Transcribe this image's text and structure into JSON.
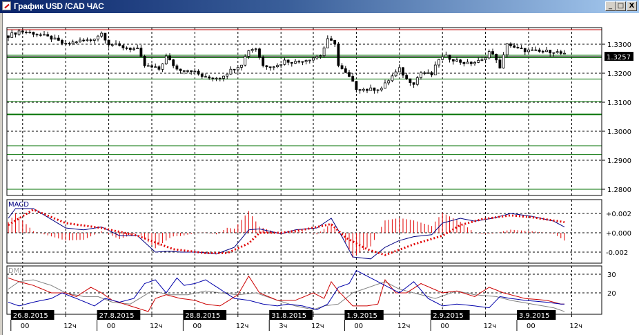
{
  "window": {
    "title": "График USD /CAD  ЧАС",
    "minimize": "_",
    "maximize": "□",
    "close": "X"
  },
  "colors": {
    "candle": "#000000",
    "resistance": "#c00000",
    "support": "#007000",
    "macd": "#000080",
    "signal": "#e00000",
    "plus_di": "#cc0000",
    "minus_di": "#0000aa",
    "adx": "#808080"
  },
  "price_axis": {
    "ticks": [
      "1.3300",
      "1.3200",
      "1.3100",
      "1.3000",
      "1.2900",
      "1.2800"
    ],
    "tick_values": [
      1.33,
      1.32,
      1.31,
      1.3,
      1.29,
      1.28
    ],
    "current_price": "1.3257",
    "current_value": 1.3257
  },
  "levels": {
    "red": [
      1.335
    ],
    "green": [
      1.3262,
      1.3254,
      1.318,
      1.3102,
      1.3058,
      1.295,
      1.292,
      1.28
    ]
  },
  "macd_panel": {
    "label": "MACD",
    "ticks": [
      "+0.002",
      "+0.000",
      "-0.002"
    ],
    "tick_values": [
      0.002,
      0,
      -0.002
    ]
  },
  "dmi_panel": {
    "label": "DMI",
    "ticks": [
      "30",
      "20"
    ],
    "tick_values": [
      30,
      20
    ]
  },
  "time_axis": {
    "labels": [
      "00",
      "12ч",
      "00",
      "12ч",
      "00",
      "12ч",
      "3ч",
      "12ч",
      "00",
      "12ч",
      "00",
      "12ч",
      "00",
      "12ч"
    ],
    "label_bars": [
      4,
      16,
      28,
      40,
      52,
      64,
      76,
      85,
      97,
      109,
      121,
      133,
      145,
      157
    ],
    "dates": [
      "26.8.2015",
      "27.8.2015",
      "28.8.2015",
      "31.8.2015",
      "1.9.2015",
      "2.9.2015",
      "3.9.2015"
    ],
    "date_bars": [
      4,
      28,
      52,
      76,
      97,
      121,
      145
    ]
  },
  "chart_data": {
    "type": "candlestick",
    "symbol": "USD/CAD",
    "timeframe": "H1",
    "bars": 156,
    "close_anchors": [
      [
        0,
        1.3329
      ],
      [
        3,
        1.3345
      ],
      [
        7,
        1.3338
      ],
      [
        12,
        1.3321
      ],
      [
        16,
        1.3298
      ],
      [
        19,
        1.331
      ],
      [
        23,
        1.3314
      ],
      [
        26,
        1.3338
      ],
      [
        28,
        1.3302
      ],
      [
        32,
        1.329
      ],
      [
        36,
        1.3281
      ],
      [
        38,
        1.3226
      ],
      [
        42,
        1.3214
      ],
      [
        44,
        1.3257
      ],
      [
        47,
        1.3214
      ],
      [
        51,
        1.321
      ],
      [
        55,
        1.3183
      ],
      [
        59,
        1.3186
      ],
      [
        62,
        1.321
      ],
      [
        65,
        1.3233
      ],
      [
        67,
        1.3281
      ],
      [
        69,
        1.3286
      ],
      [
        71,
        1.3226
      ],
      [
        75,
        1.3226
      ],
      [
        77,
        1.3243
      ],
      [
        80,
        1.3238
      ],
      [
        84,
        1.325
      ],
      [
        87,
        1.3262
      ],
      [
        89,
        1.3314
      ],
      [
        91,
        1.3305
      ],
      [
        92,
        1.3226
      ],
      [
        95,
        1.3186
      ],
      [
        97,
        1.3148
      ],
      [
        100,
        1.3143
      ],
      [
        104,
        1.3148
      ],
      [
        107,
        1.319
      ],
      [
        109,
        1.3214
      ],
      [
        111,
        1.3179
      ],
      [
        113,
        1.3167
      ],
      [
        115,
        1.3202
      ],
      [
        118,
        1.3195
      ],
      [
        120,
        1.325
      ],
      [
        122,
        1.3257
      ],
      [
        125,
        1.3243
      ],
      [
        128,
        1.3233
      ],
      [
        132,
        1.3243
      ],
      [
        134,
        1.3274
      ],
      [
        136,
        1.325
      ],
      [
        137,
        1.3214
      ],
      [
        139,
        1.3305
      ],
      [
        141,
        1.3286
      ],
      [
        144,
        1.3279
      ],
      [
        148,
        1.3274
      ],
      [
        152,
        1.3276
      ],
      [
        155,
        1.3264
      ]
    ],
    "macd_anchors": [
      [
        0,
        0.0015
      ],
      [
        2,
        0.0025
      ],
      [
        7,
        0.0025
      ],
      [
        16,
        0.0005
      ],
      [
        21,
        0.0003
      ],
      [
        26,
        0.0006
      ],
      [
        31,
        -0.0003
      ],
      [
        36,
        -0.0003
      ],
      [
        41,
        -0.002
      ],
      [
        45,
        -0.0019
      ],
      [
        48,
        -0.002
      ],
      [
        53,
        -0.002
      ],
      [
        58,
        -0.0022
      ],
      [
        63,
        -0.0015
      ],
      [
        67,
        0.0003
      ],
      [
        70,
        0.0004
      ],
      [
        76,
        -0.0001
      ],
      [
        80,
        0.0003
      ],
      [
        86,
        0.0005
      ],
      [
        90,
        0.0015
      ],
      [
        93,
        -0.0004
      ],
      [
        96,
        -0.0025
      ],
      [
        101,
        -0.0027
      ],
      [
        105,
        -0.0015
      ],
      [
        109,
        -0.0008
      ],
      [
        113,
        -0.0004
      ],
      [
        118,
        -0.0002
      ],
      [
        121,
        0.001
      ],
      [
        126,
        0.0015
      ],
      [
        130,
        0.0012
      ],
      [
        135,
        0.0015
      ],
      [
        140,
        0.002
      ],
      [
        146,
        0.0017
      ],
      [
        152,
        0.0012
      ],
      [
        155,
        0.0006
      ]
    ],
    "signal_anchors": [
      [
        0,
        0.0008
      ],
      [
        7,
        0.0024
      ],
      [
        16,
        0.001
      ],
      [
        26,
        0.0005
      ],
      [
        36,
        -0.0003
      ],
      [
        46,
        -0.0017
      ],
      [
        55,
        -0.0021
      ],
      [
        61,
        -0.0021
      ],
      [
        67,
        -0.0011
      ],
      [
        70,
        0
      ],
      [
        76,
        0
      ],
      [
        82,
        0.0003
      ],
      [
        90,
        0.0009
      ],
      [
        94,
        -0.0005
      ],
      [
        100,
        -0.0017
      ],
      [
        105,
        -0.0023
      ],
      [
        113,
        -0.0012
      ],
      [
        121,
        -0.0003
      ],
      [
        126,
        0.0008
      ],
      [
        132,
        0.0014
      ],
      [
        140,
        0.0018
      ],
      [
        146,
        0.0016
      ],
      [
        155,
        0.0011
      ]
    ],
    "minus_di_anchors": [
      [
        0,
        15
      ],
      [
        3,
        13
      ],
      [
        7,
        15
      ],
      [
        12,
        17
      ],
      [
        15,
        20
      ],
      [
        19,
        17
      ],
      [
        24,
        13
      ],
      [
        27,
        17
      ],
      [
        31,
        15
      ],
      [
        35,
        17
      ],
      [
        38,
        25
      ],
      [
        41,
        27
      ],
      [
        44,
        20
      ],
      [
        47,
        28
      ],
      [
        49,
        24
      ],
      [
        52,
        25
      ],
      [
        55,
        27
      ],
      [
        59,
        22
      ],
      [
        63,
        17
      ],
      [
        67,
        16
      ],
      [
        71,
        14
      ],
      [
        75,
        13
      ],
      [
        78,
        14
      ],
      [
        82,
        13
      ],
      [
        86,
        11
      ],
      [
        89,
        14
      ],
      [
        92,
        23
      ],
      [
        95,
        25
      ],
      [
        97,
        32
      ],
      [
        100,
        29
      ],
      [
        105,
        24
      ],
      [
        109,
        20
      ],
      [
        113,
        26
      ],
      [
        117,
        17
      ],
      [
        121,
        13
      ],
      [
        125,
        14
      ],
      [
        130,
        13
      ],
      [
        134,
        12
      ],
      [
        137,
        18
      ],
      [
        140,
        17
      ],
      [
        144,
        16
      ],
      [
        150,
        15
      ],
      [
        154,
        14
      ]
    ],
    "plus_di_anchors": [
      [
        0,
        28
      ],
      [
        3,
        26
      ],
      [
        7,
        24
      ],
      [
        12,
        20
      ],
      [
        16,
        20
      ],
      [
        19,
        18
      ],
      [
        23,
        23
      ],
      [
        26,
        20
      ],
      [
        29,
        16
      ],
      [
        34,
        13
      ],
      [
        39,
        10
      ],
      [
        41,
        17
      ],
      [
        44,
        19
      ],
      [
        48,
        17
      ],
      [
        52,
        16
      ],
      [
        55,
        14
      ],
      [
        59,
        13
      ],
      [
        64,
        19
      ],
      [
        67,
        29
      ],
      [
        70,
        20
      ],
      [
        75,
        16
      ],
      [
        80,
        16
      ],
      [
        85,
        20
      ],
      [
        88,
        17
      ],
      [
        90,
        26
      ],
      [
        92,
        21
      ],
      [
        96,
        13
      ],
      [
        100,
        13
      ],
      [
        103,
        14
      ],
      [
        105,
        27
      ],
      [
        108,
        20
      ],
      [
        111,
        20
      ],
      [
        115,
        25
      ],
      [
        121,
        20
      ],
      [
        125,
        21
      ],
      [
        130,
        18
      ],
      [
        134,
        23
      ],
      [
        138,
        20
      ],
      [
        144,
        17
      ],
      [
        150,
        16
      ],
      [
        154,
        14
      ]
    ],
    "adx_anchors": [
      [
        0,
        22
      ],
      [
        3,
        26
      ],
      [
        7,
        27
      ],
      [
        12,
        24
      ],
      [
        16,
        20
      ],
      [
        21,
        18
      ],
      [
        25,
        18
      ],
      [
        29,
        15
      ],
      [
        34,
        14
      ],
      [
        40,
        21
      ],
      [
        45,
        19
      ],
      [
        50,
        19
      ],
      [
        55,
        21
      ],
      [
        59,
        20
      ],
      [
        64,
        19
      ],
      [
        69,
        20
      ],
      [
        75,
        16
      ],
      [
        80,
        13
      ],
      [
        85,
        11
      ],
      [
        88,
        13
      ],
      [
        92,
        14
      ],
      [
        96,
        20
      ],
      [
        102,
        24
      ],
      [
        105,
        26
      ],
      [
        109,
        22
      ],
      [
        113,
        20
      ],
      [
        119,
        17
      ],
      [
        125,
        21
      ],
      [
        130,
        19
      ],
      [
        136,
        18
      ],
      [
        140,
        16
      ],
      [
        146,
        14
      ],
      [
        152,
        12
      ],
      [
        155,
        10
      ]
    ],
    "ylim": [
      1.2775,
      1.3365
    ]
  }
}
